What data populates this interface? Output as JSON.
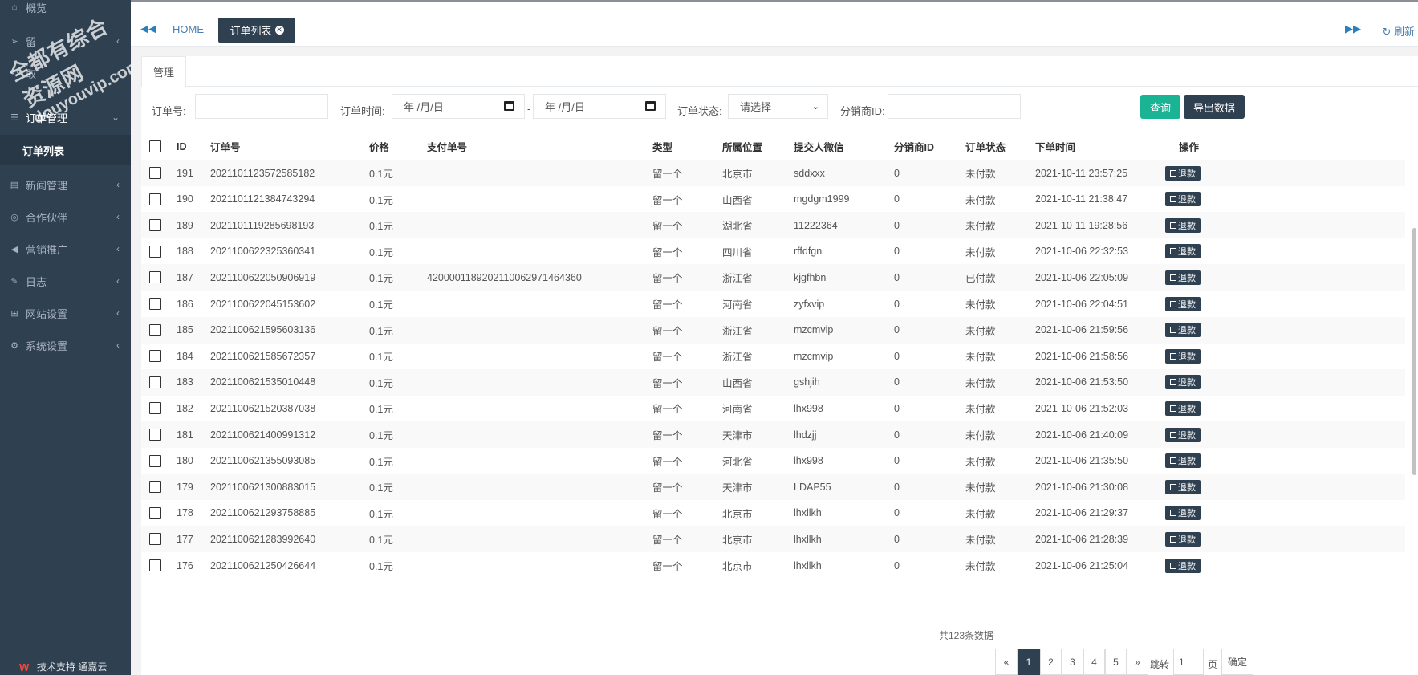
{
  "sidebar": {
    "items": [
      {
        "label": "概览",
        "icon": "home-icon"
      },
      {
        "label": "留",
        "icon": "send-icon"
      },
      {
        "label": "取",
        "icon": "reply-icon"
      },
      {
        "label": "订单管理",
        "icon": "list-icon"
      },
      {
        "label": "新闻管理",
        "icon": "newspaper-icon"
      },
      {
        "label": "合作伙伴",
        "icon": "handshake-icon"
      },
      {
        "label": "营销推广",
        "icon": "bullhorn-icon"
      },
      {
        "label": "日志",
        "icon": "edit-icon"
      },
      {
        "label": "网站设置",
        "icon": "sitemap-icon"
      },
      {
        "label": "系统设置",
        "icon": "gear-icon"
      }
    ],
    "sub_item": "订单列表",
    "footer": "技术支持 通嘉云"
  },
  "topbar": {
    "home": "HOME",
    "active_tab": "订单列表",
    "refresh": "刷新"
  },
  "panel": {
    "tab": "管理"
  },
  "filters": {
    "order_no_label": "订单号:",
    "order_time_label": "订单时间:",
    "date_placeholder": "年 /月/日",
    "date_sep": "-",
    "status_label": "订单状态:",
    "status_value": "请选择",
    "dealer_label": "分销商ID:",
    "query_button": "查询",
    "export_button": "导出数据"
  },
  "table": {
    "headers": [
      "ID",
      "订单号",
      "价格",
      "支付单号",
      "类型",
      "所属位置",
      "提交人微信",
      "分销商ID",
      "订单状态",
      "下单时间",
      "操作"
    ],
    "refund_label": "退款",
    "rows": [
      {
        "id": "191",
        "order_no": "2021101123572585182",
        "price": "0.1元",
        "pay_no": "",
        "type": "留一个",
        "location": "北京市",
        "wechat": "sddxxx",
        "dealer": "0",
        "status": "未付款",
        "time": "2021-10-11 23:57:25"
      },
      {
        "id": "190",
        "order_no": "2021101121384743294",
        "price": "0.1元",
        "pay_no": "",
        "type": "留一个",
        "location": "山西省",
        "wechat": "mgdgm1999",
        "dealer": "0",
        "status": "未付款",
        "time": "2021-10-11 21:38:47"
      },
      {
        "id": "189",
        "order_no": "2021101119285698193",
        "price": "0.1元",
        "pay_no": "",
        "type": "留一个",
        "location": "湖北省",
        "wechat": "11222364",
        "dealer": "0",
        "status": "未付款",
        "time": "2021-10-11 19:28:56"
      },
      {
        "id": "188",
        "order_no": "2021100622325360341",
        "price": "0.1元",
        "pay_no": "",
        "type": "留一个",
        "location": "四川省",
        "wechat": "rffdfgn",
        "dealer": "0",
        "status": "未付款",
        "time": "2021-10-06 22:32:53"
      },
      {
        "id": "187",
        "order_no": "2021100622050906919",
        "price": "0.1元",
        "pay_no": "4200001189202110062971464360",
        "type": "留一个",
        "location": "浙江省",
        "wechat": "kjgfhbn",
        "dealer": "0",
        "status": "已付款",
        "time": "2021-10-06 22:05:09"
      },
      {
        "id": "186",
        "order_no": "2021100622045153602",
        "price": "0.1元",
        "pay_no": "",
        "type": "留一个",
        "location": "河南省",
        "wechat": "zyfxvip",
        "dealer": "0",
        "status": "未付款",
        "time": "2021-10-06 22:04:51"
      },
      {
        "id": "185",
        "order_no": "2021100621595603136",
        "price": "0.1元",
        "pay_no": "",
        "type": "留一个",
        "location": "浙江省",
        "wechat": "mzcmvip",
        "dealer": "0",
        "status": "未付款",
        "time": "2021-10-06 21:59:56"
      },
      {
        "id": "184",
        "order_no": "2021100621585672357",
        "price": "0.1元",
        "pay_no": "",
        "type": "留一个",
        "location": "浙江省",
        "wechat": "mzcmvip",
        "dealer": "0",
        "status": "未付款",
        "time": "2021-10-06 21:58:56"
      },
      {
        "id": "183",
        "order_no": "2021100621535010448",
        "price": "0.1元",
        "pay_no": "",
        "type": "留一个",
        "location": "山西省",
        "wechat": "gshjih",
        "dealer": "0",
        "status": "未付款",
        "time": "2021-10-06 21:53:50"
      },
      {
        "id": "182",
        "order_no": "2021100621520387038",
        "price": "0.1元",
        "pay_no": "",
        "type": "留一个",
        "location": "河南省",
        "wechat": "lhx998",
        "dealer": "0",
        "status": "未付款",
        "time": "2021-10-06 21:52:03"
      },
      {
        "id": "181",
        "order_no": "2021100621400991312",
        "price": "0.1元",
        "pay_no": "",
        "type": "留一个",
        "location": "天津市",
        "wechat": "lhdzjj",
        "dealer": "0",
        "status": "未付款",
        "time": "2021-10-06 21:40:09"
      },
      {
        "id": "180",
        "order_no": "2021100621355093085",
        "price": "0.1元",
        "pay_no": "",
        "type": "留一个",
        "location": "河北省",
        "wechat": "lhx998",
        "dealer": "0",
        "status": "未付款",
        "time": "2021-10-06 21:35:50"
      },
      {
        "id": "179",
        "order_no": "2021100621300883015",
        "price": "0.1元",
        "pay_no": "",
        "type": "留一个",
        "location": "天津市",
        "wechat": "LDAP55",
        "dealer": "0",
        "status": "未付款",
        "time": "2021-10-06 21:30:08"
      },
      {
        "id": "178",
        "order_no": "2021100621293758885",
        "price": "0.1元",
        "pay_no": "",
        "type": "留一个",
        "location": "北京市",
        "wechat": "lhxllkh",
        "dealer": "0",
        "status": "未付款",
        "time": "2021-10-06 21:29:37"
      },
      {
        "id": "177",
        "order_no": "2021100621283992640",
        "price": "0.1元",
        "pay_no": "",
        "type": "留一个",
        "location": "北京市",
        "wechat": "lhxllkh",
        "dealer": "0",
        "status": "未付款",
        "time": "2021-10-06 21:28:39"
      },
      {
        "id": "176",
        "order_no": "2021100621250426644",
        "price": "0.1元",
        "pay_no": "",
        "type": "留一个",
        "location": "北京市",
        "wechat": "lhxllkh",
        "dealer": "0",
        "status": "未付款",
        "time": "2021-10-06 21:25:04"
      }
    ]
  },
  "pagination": {
    "info": "共123条数据",
    "prev": "«",
    "pages": [
      "1",
      "2",
      "3",
      "4",
      "5"
    ],
    "next": "»",
    "jump_label": "跳转",
    "jump_value": "1",
    "page_unit": "页",
    "confirm": "确定"
  },
  "watermark": {
    "line1": "全都有综合资源网",
    "line2": "douyouvip.com"
  },
  "colors": {
    "sidebar": "#2f4050",
    "accent": "#1ab394",
    "link": "#4a7fb0"
  }
}
